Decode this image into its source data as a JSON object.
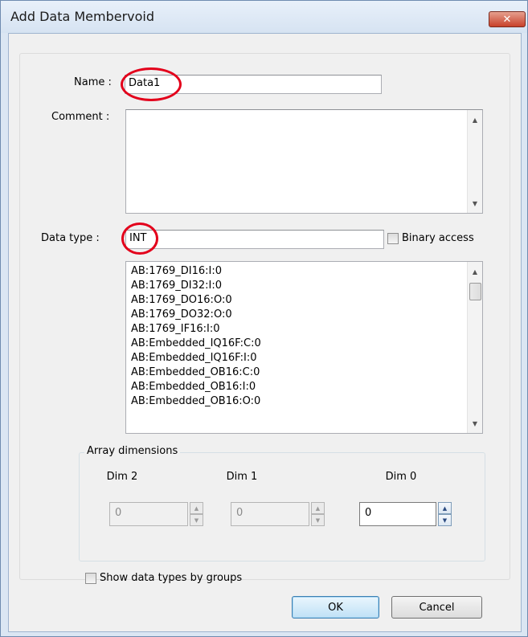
{
  "window": {
    "title": "Add Data Membervoid",
    "close_glyph": "✕"
  },
  "form": {
    "name_label": "Name :",
    "name_value": "Data1",
    "comment_label": "Comment :",
    "comment_value": "",
    "data_type_label": "Data type :",
    "data_type_value": "INT",
    "binary_access_label": "Binary access",
    "binary_access_checked": false
  },
  "type_list": {
    "items": [
      "AB:1769_DI16:I:0",
      "AB:1769_DI32:I:0",
      "AB:1769_DO16:O:0",
      "AB:1769_DO32:O:0",
      "AB:1769_IF16:I:0",
      "AB:Embedded_IQ16F:C:0",
      "AB:Embedded_IQ16F:I:0",
      "AB:Embedded_OB16:C:0",
      "AB:Embedded_OB16:I:0",
      "AB:Embedded_OB16:O:0"
    ]
  },
  "array_dimensions": {
    "legend": "Array dimensions",
    "dims": [
      {
        "label": "Dim 2",
        "value": "0",
        "enabled": false
      },
      {
        "label": "Dim 1",
        "value": "0",
        "enabled": false
      },
      {
        "label": "Dim 0",
        "value": "0",
        "enabled": true
      }
    ]
  },
  "options": {
    "show_by_groups_label": "Show data types by groups",
    "show_by_groups_checked": false
  },
  "buttons": {
    "ok_label": "OK",
    "cancel_label": "Cancel"
  },
  "annotations": {
    "highlight_color": "#e3001b"
  },
  "icons": [
    "close-icon",
    "scroll-up-icon",
    "scroll-down-icon",
    "spin-up-icon",
    "spin-down-icon"
  ]
}
